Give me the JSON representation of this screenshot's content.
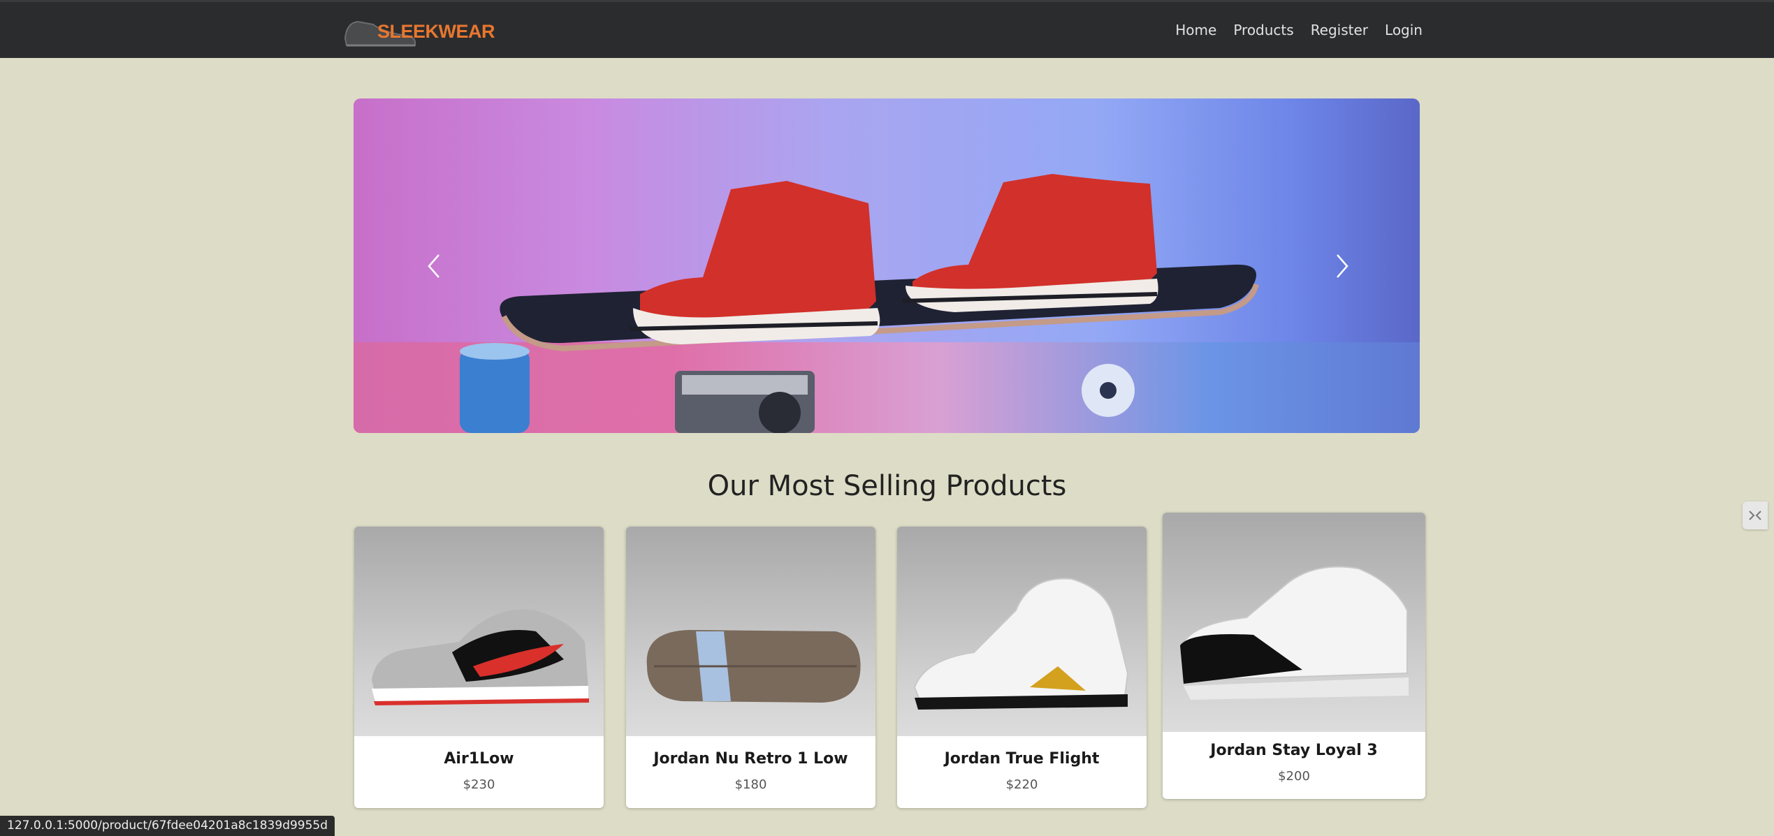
{
  "navbar": {
    "brand": "SLEEKWEAR",
    "links": [
      "Home",
      "Products",
      "Register",
      "Login"
    ]
  },
  "carousel": {
    "prev_icon": "chevron-left-icon",
    "next_icon": "chevron-right-icon"
  },
  "section": {
    "title": "Our Most Selling Products"
  },
  "products": [
    {
      "name": "Air1Low",
      "price": "$230"
    },
    {
      "name": "Jordan Nu Retro 1 Low",
      "price": "$180"
    },
    {
      "name": "Jordan True Flight",
      "price": "$220"
    },
    {
      "name": "Jordan Stay Loyal 3",
      "price": "$200"
    }
  ],
  "status_bar": {
    "url": "127.0.0.1:5000/product/67fdee04201a8c1839d9955d"
  },
  "colors": {
    "brand": "#e8772e",
    "navbar_bg": "#2b2c2e",
    "page_bg": "#dddcc6"
  }
}
